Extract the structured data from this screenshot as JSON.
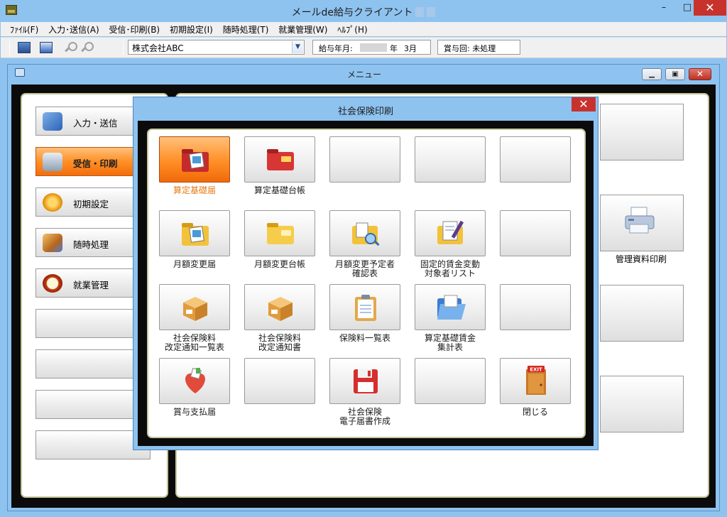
{
  "window": {
    "title": "メールde給与クライアント",
    "controls": {
      "minimize": "–",
      "maximize": "□",
      "close": "✕"
    }
  },
  "menu_bar": [
    "ﾌｧｲﾙ(F)",
    "入力･送信(A)",
    "受信･印刷(B)",
    "初期設定(I)",
    "随時処理(T)",
    "就業管理(W)",
    "ﾍﾙﾌﾟ(H)"
  ],
  "toolbar": {
    "company": "株式会社ABC",
    "pay_year_label": "給与年月:",
    "pay_year_suffix": "年",
    "pay_month": "3月",
    "bonus_label": "賞与回: 未処理"
  },
  "menu_window": {
    "title": "メニュー",
    "nav": [
      {
        "label": "入力・送信",
        "icon": "envelope-box-icon",
        "active": false
      },
      {
        "label": "受信・印刷",
        "icon": "printer-icon",
        "active": true
      },
      {
        "label": "初期設定",
        "icon": "gear-icon",
        "active": false
      },
      {
        "label": "随時処理",
        "icon": "tools-icon",
        "active": false
      },
      {
        "label": "就業管理",
        "icon": "clock-icon",
        "active": false
      }
    ],
    "right_button_label": "管理資料印刷"
  },
  "dialog": {
    "title": "社会保険印刷",
    "close": "✕",
    "buttons": [
      {
        "label": "算定基礎届",
        "icon": "red-folder-photos-icon",
        "active": true
      },
      {
        "label": "算定基礎台帳",
        "icon": "red-folder-icon",
        "active": false
      },
      {
        "label": "",
        "icon": "",
        "active": false
      },
      {
        "label": "",
        "icon": "",
        "active": false
      },
      {
        "label": "",
        "icon": "",
        "active": false
      },
      {
        "label": "月額変更届",
        "icon": "yellow-folder-photos-icon",
        "active": false
      },
      {
        "label": "月額変更台帳",
        "icon": "yellow-folder-icon",
        "active": false
      },
      {
        "label": "月額変更予定者\n確認表",
        "icon": "folder-search-icon",
        "active": false
      },
      {
        "label": "固定的賃金変動\n対象者リスト",
        "icon": "folder-pen-icon",
        "active": false
      },
      {
        "label": "",
        "icon": "",
        "active": false
      },
      {
        "label": "社会保険料\n改定通知一覧表",
        "icon": "cardboard-box-icon",
        "active": false
      },
      {
        "label": "社会保険料\n改定通知書",
        "icon": "cardboard-box-icon",
        "active": false
      },
      {
        "label": "保険料一覧表",
        "icon": "clipboard-icon",
        "active": false
      },
      {
        "label": "算定基礎賃金\n集計表",
        "icon": "blue-folder-open-icon",
        "active": false
      },
      {
        "label": "",
        "icon": "",
        "active": false
      },
      {
        "label": "賞与支払届",
        "icon": "gift-heart-icon",
        "active": false
      },
      {
        "label": "",
        "icon": "",
        "active": false
      },
      {
        "label": "社会保険\n電子届書作成",
        "icon": "floppy-disk-icon",
        "active": false
      },
      {
        "label": "",
        "icon": "",
        "active": false
      },
      {
        "label": "閉じる",
        "icon": "exit-door-icon",
        "active": false
      }
    ]
  }
}
